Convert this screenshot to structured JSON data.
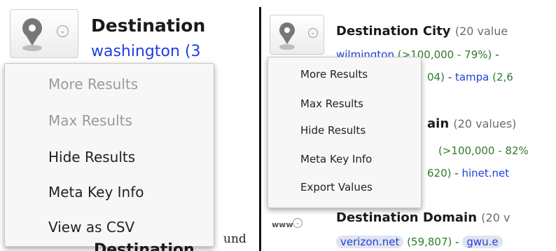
{
  "left": {
    "title": "Destination",
    "value_line": "washington (3",
    "menu": [
      {
        "label": "More Results",
        "enabled": false
      },
      {
        "label": "Max Results",
        "enabled": false
      },
      {
        "label": "Hide Results",
        "enabled": true
      },
      {
        "label": "Meta Key Info",
        "enabled": true
      },
      {
        "label": "View as CSV",
        "enabled": true
      }
    ],
    "bottom_partial": "Destination"
  },
  "conjunction": "und",
  "right": {
    "city": {
      "title": "Destination City",
      "count": "(20 value",
      "line1_link": "wilmington",
      "line1_count": "(>100,000 - 79%)",
      "line1_sep": "-",
      "line2_count": "04)",
      "line2_sep": "-",
      "line2_link": "tampa",
      "line2_tail": "(2,6"
    },
    "domain_block": {
      "title_tail": "ain",
      "count": "(20 values)",
      "line1_count": "(>100,000 - 82%",
      "line2_count": "620)",
      "line2_sep": "-",
      "line2_link": "hinet.net"
    },
    "dest_domain": {
      "www_label": "www",
      "title": "Destination Domain",
      "count": "(20 v",
      "value1": "verizon.net",
      "value1_count": "(59,807)",
      "sep": "-",
      "value2": "gwu.e"
    },
    "menu": [
      {
        "label": "More Results",
        "enabled": true
      },
      {
        "label": "Max Results",
        "enabled": true
      },
      {
        "label": "Hide Results",
        "enabled": true
      },
      {
        "label": "Meta Key Info",
        "enabled": true
      },
      {
        "label": "Export Values",
        "enabled": true
      }
    ]
  },
  "icons": {
    "meta_button": "location-pin-icon",
    "dropdown": "chevron-down-circle-icon"
  }
}
